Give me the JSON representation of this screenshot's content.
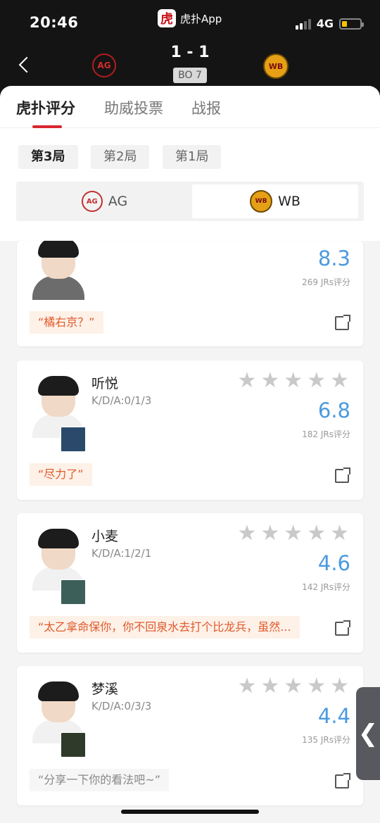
{
  "status_bar": {
    "time": "20:46",
    "app": "虎扑App",
    "app_icon": "虎",
    "network": "4G",
    "battery_fraction": 0.3
  },
  "match": {
    "score": "1 - 1",
    "format": "BO 7",
    "team_left": "AG",
    "team_right": "WB"
  },
  "tabs": [
    {
      "label": "虎扑评分"
    },
    {
      "label": "助威投票"
    },
    {
      "label": "战报"
    }
  ],
  "rounds": [
    {
      "label": "第3局"
    },
    {
      "label": "第2局"
    },
    {
      "label": "第1局"
    }
  ],
  "team_switch": [
    {
      "label": "AG"
    },
    {
      "label": "WB"
    }
  ],
  "players": [
    {
      "name": "",
      "kda": "",
      "rating": "8.3",
      "votes": "269 JRs评分",
      "comment": "“橘右京？”"
    },
    {
      "name": "听悦",
      "kda": "K/D/A:0/1/3",
      "rating": "6.8",
      "votes": "182 JRs评分",
      "comment": "“尽力了”"
    },
    {
      "name": "小麦",
      "kda": "K/D/A:1/2/1",
      "rating": "4.6",
      "votes": "142 JRs评分",
      "comment": "“太乙拿命保你，你不回泉水去打个比龙兵，虽然..."
    },
    {
      "name": "梦溪",
      "kda": "K/D/A:0/3/3",
      "rating": "4.4",
      "votes": "135 JRs评分",
      "comment": "“分享一下你的看法吧~”"
    }
  ],
  "side_handle": "❮",
  "icons": {
    "back": "chevron-left-icon",
    "share": "share-icon",
    "star": "star-icon"
  },
  "colors": {
    "accent_red": "#d9272e",
    "rating_blue": "#4b9ae0",
    "comment_orange": "#e05a2b"
  }
}
